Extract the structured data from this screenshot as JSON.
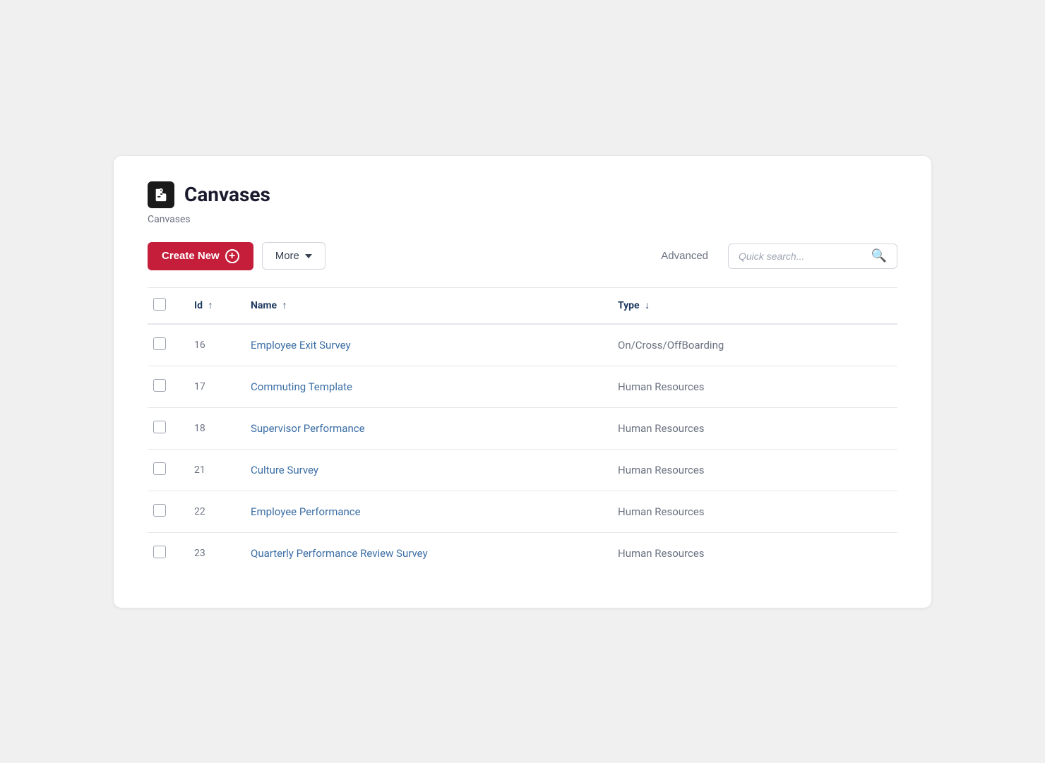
{
  "page": {
    "title": "Canvases",
    "breadcrumb": "Canvases",
    "icon": "canvases-icon"
  },
  "toolbar": {
    "create_label": "Create New",
    "more_label": "More",
    "advanced_label": "Advanced",
    "search_placeholder": "Quick search..."
  },
  "table": {
    "columns": [
      {
        "key": "checkbox",
        "label": ""
      },
      {
        "key": "id",
        "label": "Id ↑",
        "sort": "asc"
      },
      {
        "key": "name",
        "label": "Name ↑",
        "sort": "asc"
      },
      {
        "key": "type",
        "label": "Type ↓",
        "sort": "desc"
      }
    ],
    "rows": [
      {
        "id": "16",
        "name": "Employee Exit Survey",
        "type": "On/Cross/OffBoarding"
      },
      {
        "id": "17",
        "name": "Commuting Template",
        "type": "Human Resources"
      },
      {
        "id": "18",
        "name": "Supervisor Performance",
        "type": "Human Resources"
      },
      {
        "id": "21",
        "name": "Culture Survey",
        "type": "Human Resources"
      },
      {
        "id": "22",
        "name": "Employee Performance",
        "type": "Human Resources"
      },
      {
        "id": "23",
        "name": "Quarterly Performance Review Survey",
        "type": "Human Resources"
      }
    ]
  }
}
